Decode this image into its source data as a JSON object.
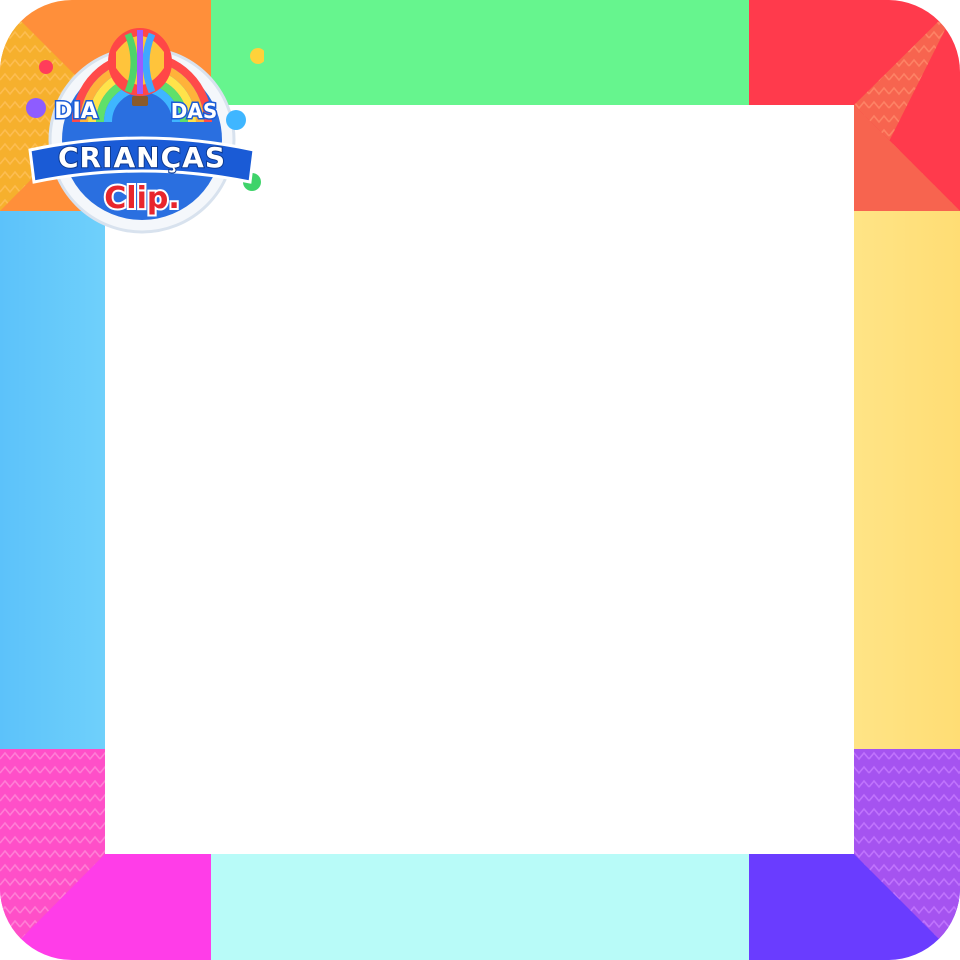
{
  "badge": {
    "line1_left": "DIA",
    "line1_right": "DAS",
    "line2": "CRIANÇAS",
    "brand": "Clip."
  },
  "colors": {
    "top_left_corner": "#ff8f3a",
    "top_edge": "#66f58e",
    "top_right_corner": "#ff3a4c",
    "right_corner_top": "#f7644f",
    "right_edge": "#ffe07a",
    "right_corner_bottom": "#a553f0",
    "bottom_right_corner": "#6a3cff",
    "bottom_edge": "#b8fbf8",
    "bottom_left_corner": "#ff3de8",
    "left_corner_bottom": "#ff4fc8",
    "left_edge": "#62c8fb",
    "left_corner_top": "#f6b02d",
    "center": "#ffffff",
    "badge_blue": "#1a5bd6",
    "badge_text": "#ffffff",
    "brand_red": "#e8262c"
  },
  "icons": {
    "balloon": "hot-air-balloon-icon",
    "rainbow": "rainbow-icon"
  }
}
